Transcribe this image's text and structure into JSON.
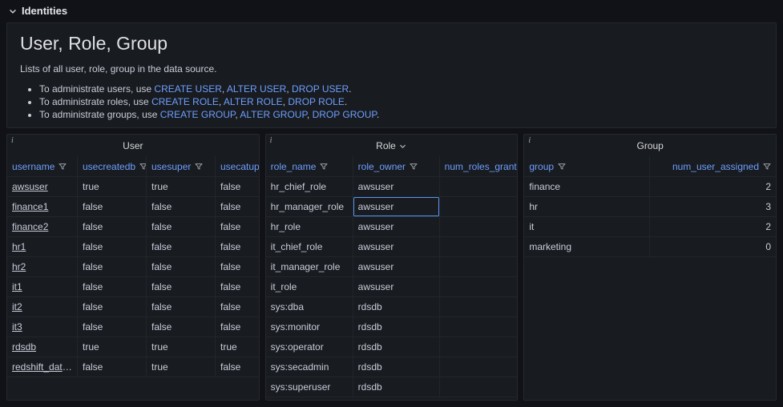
{
  "colors": {
    "page_background": "#111217",
    "panel_background": "#181b1f",
    "link_blue": "#6e9fff",
    "selected_cell_border": "#5794f2",
    "text": "#ccccdc"
  },
  "section": {
    "title": "Identities"
  },
  "text_panel": {
    "title": "User, Role, Group",
    "subtitle": "Lists of all user, role, group in the data source.",
    "bullets": [
      {
        "text": "To administrate users, use ",
        "links": [
          "CREATE USER",
          "ALTER USER",
          "DROP USER"
        ]
      },
      {
        "text": "To administrate roles, use ",
        "links": [
          "CREATE ROLE",
          "ALTER ROLE",
          "DROP ROLE"
        ]
      },
      {
        "text": "To administrate groups, use ",
        "links": [
          "CREATE GROUP",
          "ALTER GROUP",
          "DROP GROUP"
        ]
      }
    ]
  },
  "tables": [
    {
      "id": "user",
      "title": "User",
      "title_chevron": false,
      "link_col": 0,
      "columns": [
        {
          "label": "username",
          "filter": true
        },
        {
          "label": "usecreatedb",
          "filter": true
        },
        {
          "label": "usesuper",
          "filter": true
        },
        {
          "label": "usecatupd",
          "filter": true
        }
      ],
      "rows": [
        [
          "awsuser",
          "true",
          "true",
          "false"
        ],
        [
          "finance1",
          "false",
          "false",
          "false"
        ],
        [
          "finance2",
          "false",
          "false",
          "false"
        ],
        [
          "hr1",
          "false",
          "false",
          "false"
        ],
        [
          "hr2",
          "false",
          "false",
          "false"
        ],
        [
          "it1",
          "false",
          "false",
          "false"
        ],
        [
          "it2",
          "false",
          "false",
          "false"
        ],
        [
          "it3",
          "false",
          "false",
          "false"
        ],
        [
          "rdsdb",
          "true",
          "true",
          "true"
        ],
        [
          "redshift_data_...",
          "false",
          "true",
          "false"
        ]
      ]
    },
    {
      "id": "role",
      "title": "Role",
      "title_chevron": true,
      "selected_cell": {
        "row": 1,
        "col": 1
      },
      "columns": [
        {
          "label": "role_name",
          "filter": true
        },
        {
          "label": "role_owner",
          "filter": true
        },
        {
          "label": "num_roles_granted",
          "filter": true
        }
      ],
      "rows": [
        [
          "hr_chief_role",
          "awsuser",
          ""
        ],
        [
          "hr_manager_role",
          "awsuser",
          ""
        ],
        [
          "hr_role",
          "awsuser",
          ""
        ],
        [
          "it_chief_role",
          "awsuser",
          ""
        ],
        [
          "it_manager_role",
          "awsuser",
          ""
        ],
        [
          "it_role",
          "awsuser",
          ""
        ],
        [
          "sys:dba",
          "rdsdb",
          ""
        ],
        [
          "sys:monitor",
          "rdsdb",
          ""
        ],
        [
          "sys:operator",
          "rdsdb",
          ""
        ],
        [
          "sys:secadmin",
          "rdsdb",
          ""
        ],
        [
          "sys:superuser",
          "rdsdb",
          ""
        ]
      ]
    },
    {
      "id": "group",
      "title": "Group",
      "title_chevron": false,
      "columns": [
        {
          "label": "group",
          "filter": true
        },
        {
          "label": "num_user_assigned",
          "filter": true
        }
      ],
      "rows": [
        [
          "finance",
          "2"
        ],
        [
          "hr",
          "3"
        ],
        [
          "it",
          "2"
        ],
        [
          "marketing",
          "0"
        ]
      ]
    }
  ]
}
